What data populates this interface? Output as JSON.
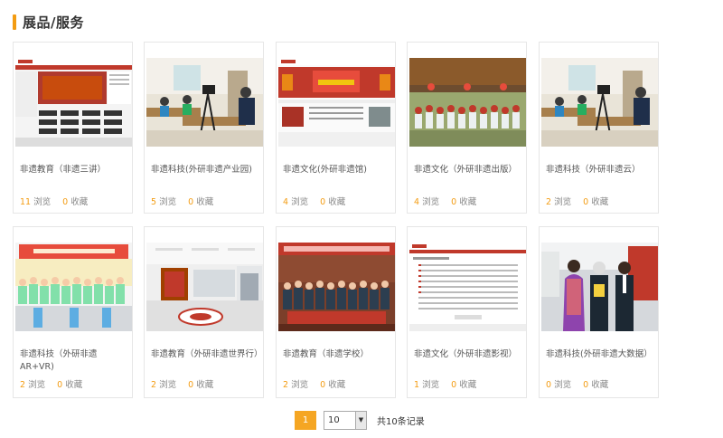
{
  "section": {
    "title": "展品/服务",
    "accent": "#f39c12"
  },
  "stats_labels": {
    "views": "浏览",
    "favorites": "收藏"
  },
  "items": [
    {
      "title": "非遗教育（非遗三讲）",
      "views": "11",
      "favorites": "0",
      "thumb": "website"
    },
    {
      "title": "非遗科技(外研非遗产业园)",
      "views": "5",
      "favorites": "0",
      "thumb": "classroom"
    },
    {
      "title": "非遗文化(外研非遗馆)",
      "views": "4",
      "favorites": "0",
      "thumb": "website-red-banner"
    },
    {
      "title": "非遗文化（外研非遗出版）",
      "views": "4",
      "favorites": "0",
      "thumb": "group-photo-pavilion"
    },
    {
      "title": "非遗科技（外研非遗云）",
      "views": "2",
      "favorites": "0",
      "thumb": "classroom"
    },
    {
      "title": "非遗科技（外研非遗AR+VR)",
      "views": "2",
      "favorites": "0",
      "thumb": "children-group"
    },
    {
      "title": "非遗教育（外研非遗世界行）",
      "views": "2",
      "favorites": "0",
      "thumb": "lobby"
    },
    {
      "title": "非遗教育（非遗学校）",
      "views": "2",
      "favorites": "0",
      "thumb": "group-photo-banner"
    },
    {
      "title": "非遗文化（外研非遗影视）",
      "views": "1",
      "favorites": "0",
      "thumb": "website-list"
    },
    {
      "title": "非遗科技(外研非遗大数据）",
      "views": "0",
      "favorites": "0",
      "thumb": "award-ceremony"
    }
  ],
  "pager": {
    "current": "1",
    "page_size": "10",
    "total": "共10条记录"
  }
}
